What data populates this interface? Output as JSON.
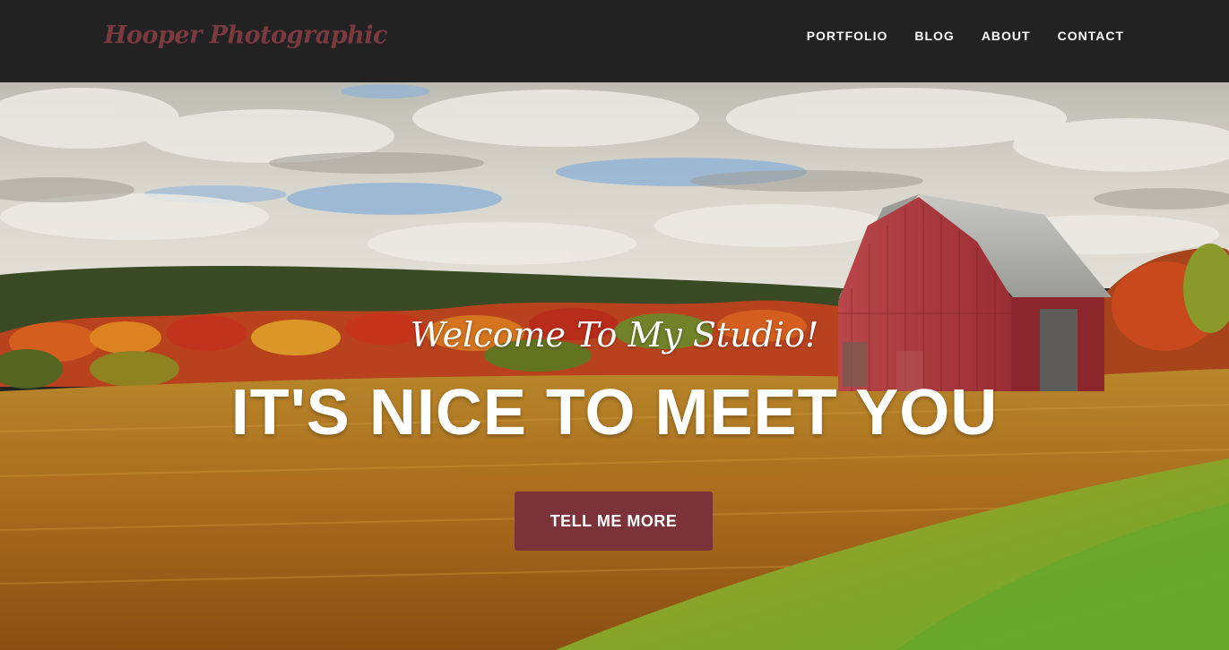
{
  "navbar": {
    "brand": "Hooper Photographic",
    "links": [
      "PORTFOLIO",
      "BLOG",
      "ABOUT",
      "CONTACT"
    ]
  },
  "hero": {
    "lead": "Welcome To My Studio!",
    "heading": "IT'S NICE TO MEET YOU",
    "button": "TELL ME MORE",
    "image": "farm-barn-autumn-landscape"
  },
  "colors": {
    "navbar_bg": "#222222",
    "brand": "#7a3a40",
    "button_bg": "#7b3238",
    "text": "#ffffff"
  }
}
